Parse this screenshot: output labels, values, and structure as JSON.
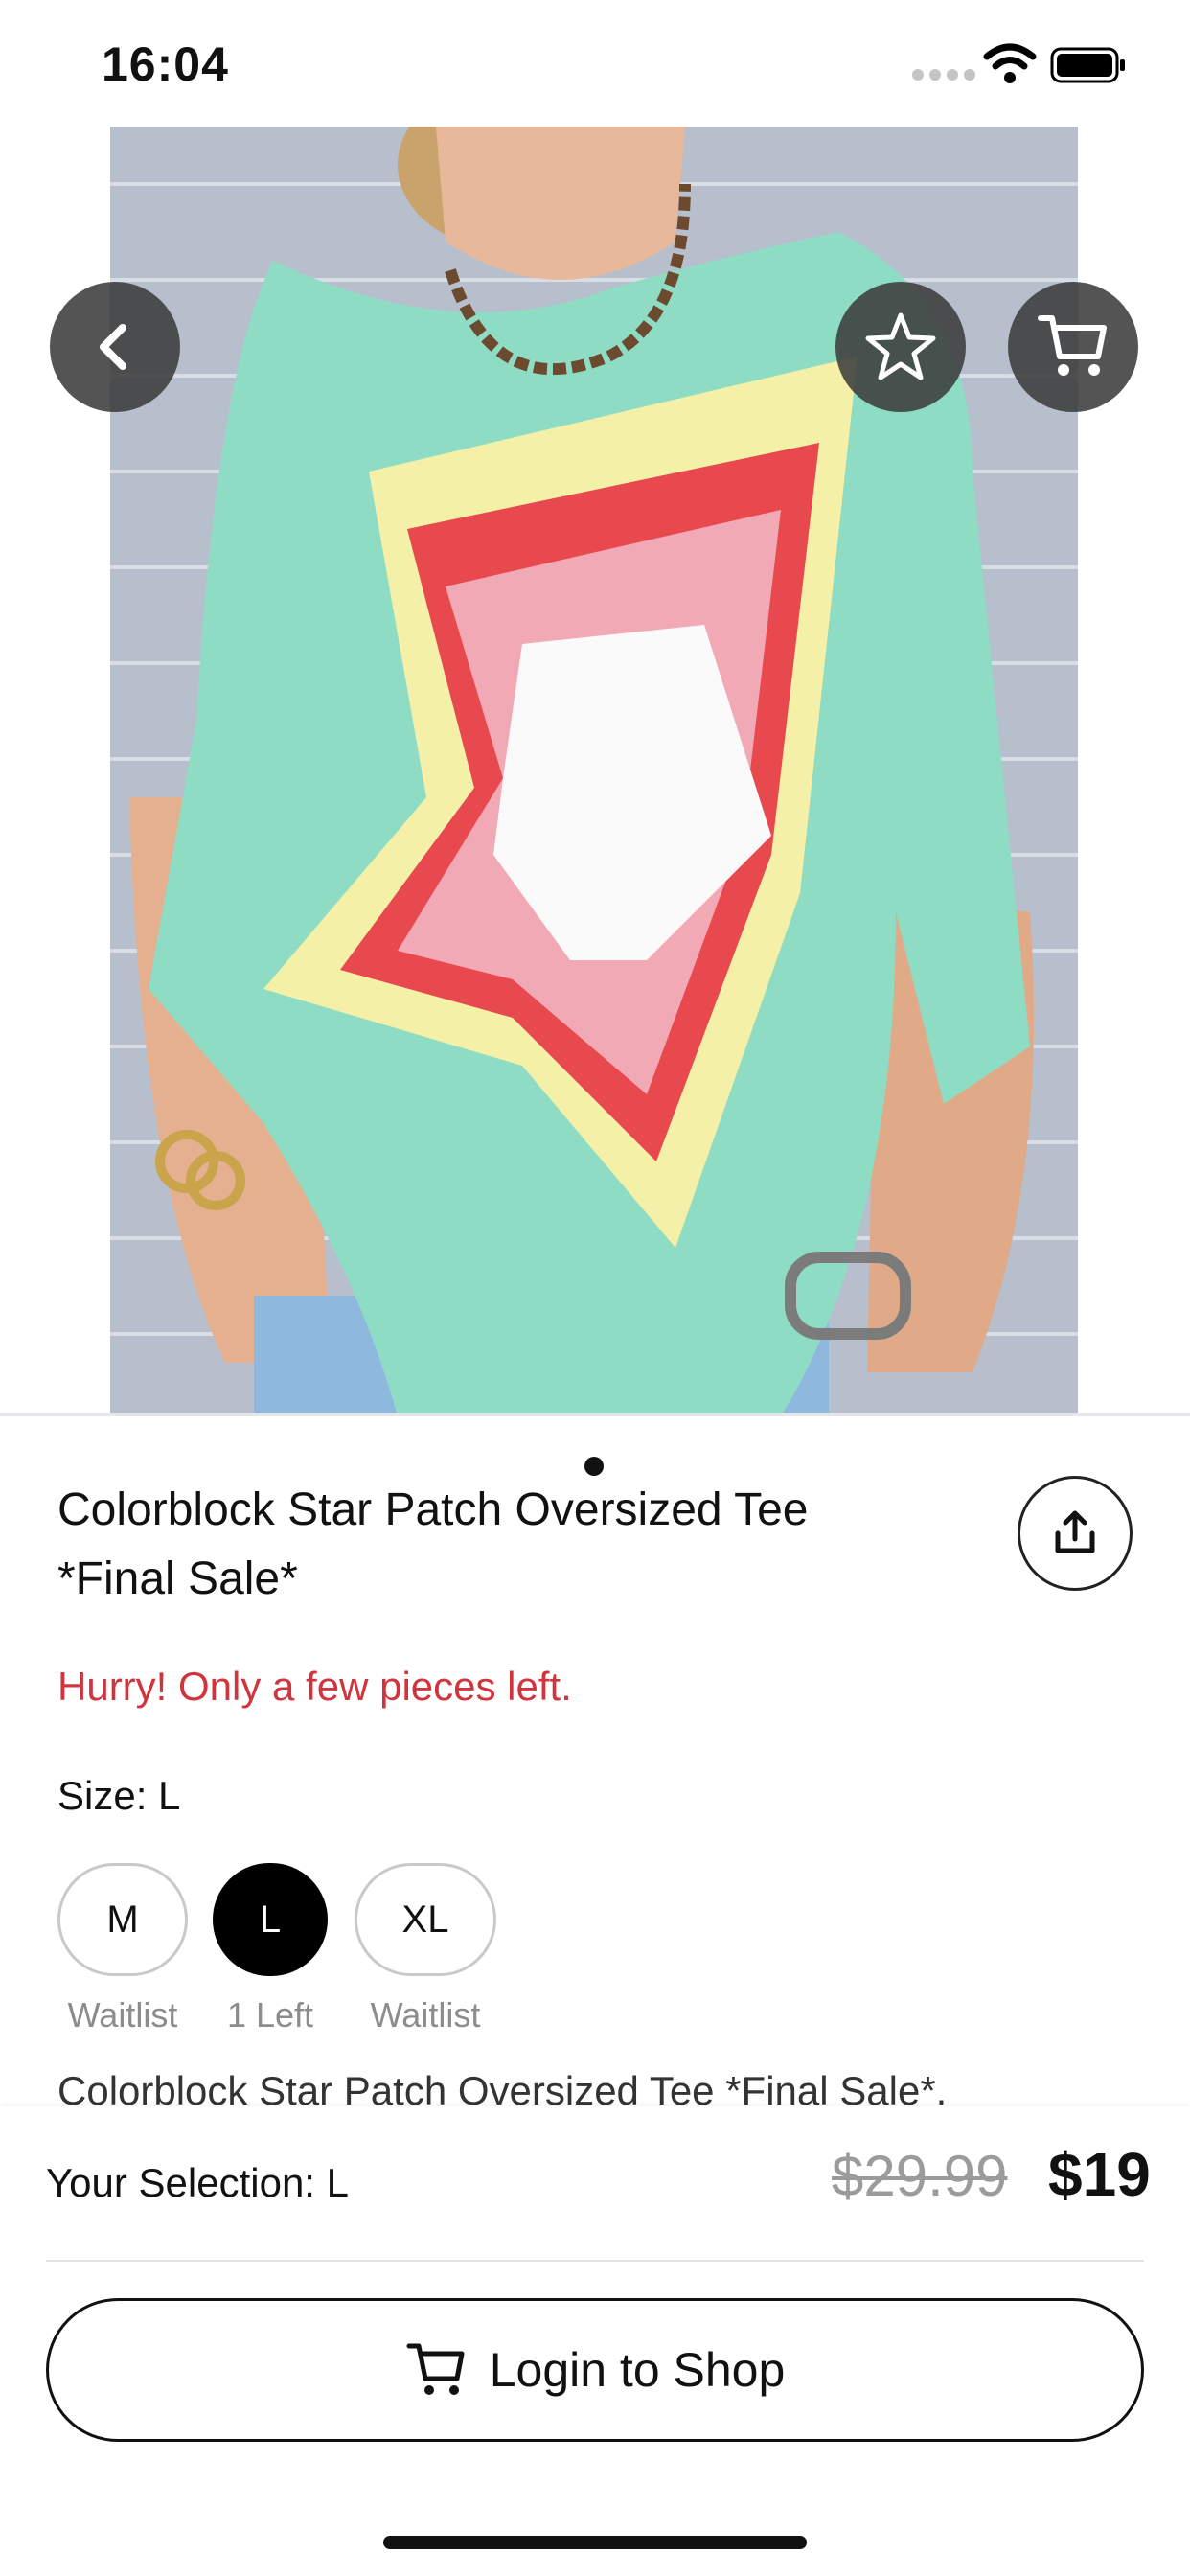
{
  "status_bar": {
    "time": "16:04"
  },
  "hero": {
    "back_icon": "chevron-left-icon",
    "favorite_icon": "star-outline-icon",
    "cart_icon": "cart-icon",
    "page_count": 1,
    "current_page": 1
  },
  "product": {
    "title": "Colorblock Star Patch Oversized Tee *Final Sale*",
    "stock_alert": "Hurry! Only a few pieces left.",
    "size_label": "Size: L",
    "description_preview": "Colorblock Star Patch Oversized Tee *Final Sale*."
  },
  "sizes": [
    {
      "label": "M",
      "note": "Waitlist",
      "selected": false
    },
    {
      "label": "L",
      "note": "1 Left",
      "selected": true
    },
    {
      "label": "XL",
      "note": "Waitlist",
      "selected": false
    }
  ],
  "bottom_bar": {
    "selection": "Your Selection: L",
    "original_price": "$29.99",
    "sale_price": "$19",
    "cta_label": "Login to Shop"
  },
  "colors": {
    "alert_red": "#d0353e",
    "selected_chip": "#000000",
    "shirt_mint": "#8fdcc4"
  }
}
